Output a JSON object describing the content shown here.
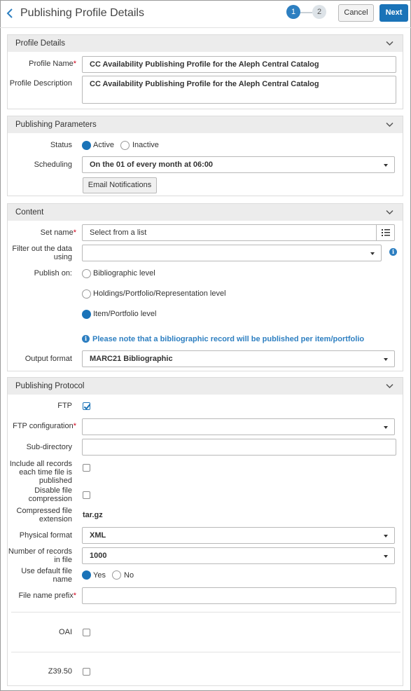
{
  "header": {
    "title": "Publishing Profile Details",
    "step1": "1",
    "step2": "2",
    "cancel_label": "Cancel",
    "next_label": "Next"
  },
  "profile_details": {
    "title": "Profile Details",
    "name_label": "Profile Name",
    "name_value": "CC Availability Publishing Profile for the Aleph Central Catalog",
    "description_label": "Profile Description",
    "description_value": "CC Availability Publishing Profile for the Aleph Central Catalog"
  },
  "publishing_parameters": {
    "title": "Publishing Parameters",
    "status_label": "Status",
    "status_active": "Active",
    "status_inactive": "Inactive",
    "scheduling_label": "Scheduling",
    "scheduling_value": "On the 01 of every month at 06:00",
    "email_button": "Email Notifications"
  },
  "content": {
    "title": "Content",
    "set_name_label": "Set name",
    "set_name_placeholder": "Select from a list",
    "filter_label_line1": "Filter out the data",
    "filter_label_line2": "using",
    "filter_value": "",
    "publish_on_label": "Publish on:",
    "opt_bib": "Bibliographic level",
    "opt_holdings": "Holdings/Portfolio/Representation level",
    "opt_item": "Item/Portfolio level",
    "notice": "Please note that a bibliographic record will be published per item/portfolio",
    "output_format_label": "Output format",
    "output_format_value": "MARC21 Bibliographic"
  },
  "protocol": {
    "title": "Publishing Protocol",
    "ftp_label": "FTP",
    "ftp_checked": true,
    "ftp_config_label": "FTP configuration",
    "ftp_config_value": "",
    "subdir_label": "Sub-directory",
    "subdir_value": "",
    "include_all_line1": "Include all records",
    "include_all_line2": "each time file is",
    "include_all_line3": "published",
    "disable_comp_line1": "Disable file",
    "disable_comp_line2": "compression",
    "compressed_ext_line1": "Compressed file",
    "compressed_ext_line2": "extension",
    "compressed_ext_value": "tar.gz",
    "physical_format_label": "Physical format",
    "physical_format_value": "XML",
    "num_records_line1": "Number of records",
    "num_records_line2": "in file",
    "num_records_value": "1000",
    "default_name_line1": "Use default file",
    "default_name_line2": "name",
    "yes": "Yes",
    "no": "No",
    "prefix_label": "File name prefix",
    "prefix_value": "",
    "oai_label": "OAI",
    "z3950_label": "Z39.50"
  },
  "colors": {
    "accent": "#1a73b8",
    "required": "#d0021b",
    "section_header": "#ececec"
  }
}
